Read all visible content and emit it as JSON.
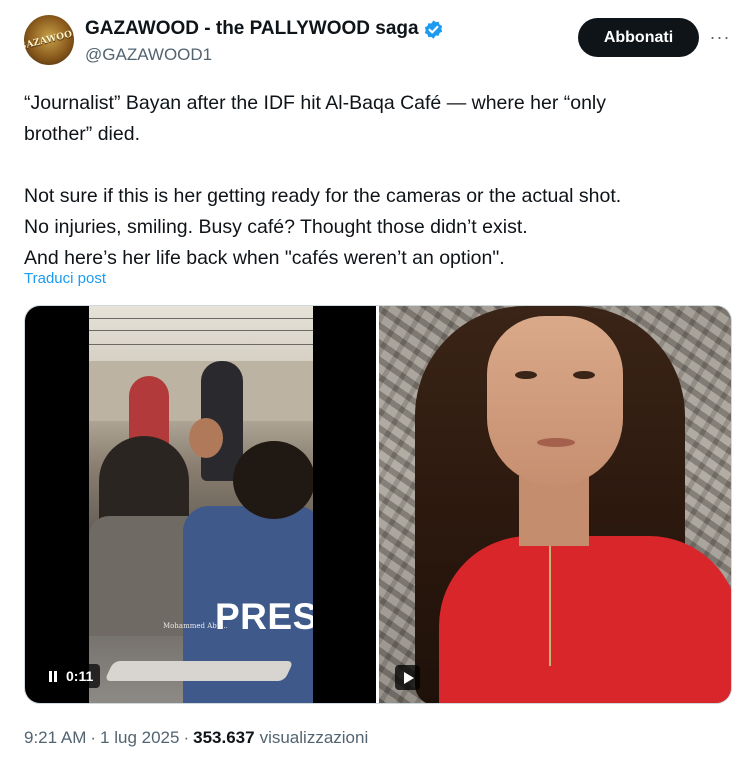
{
  "author": {
    "display_name": "GAZAWOOD - the PALLYWOOD saga",
    "handle": "@GAZAWOOD1",
    "avatar_text": "GAZAWOOD",
    "verified": true,
    "verified_color": "#1d9bf0"
  },
  "actions": {
    "follow_label": "Abbonati",
    "more_label": "···"
  },
  "tweet": {
    "lines": [
      "“Journalist” Bayan after the IDF hit Al-Baqa Café — where her “only",
      "brother” died.",
      "Not sure if this is her getting ready for the cameras or the actual shot.",
      "No injuries, smiling. Busy café? Thought those didn’t exist.",
      "And here’s her life back when \"cafés weren’t an option\"."
    ],
    "translate_label": "Traduci post"
  },
  "media": {
    "video_left": {
      "timestamp": "0:11",
      "state": "playing",
      "vest_text": "PRES",
      "watermark": "Mohammed Abu..."
    },
    "video_right": {
      "state": "paused"
    }
  },
  "meta": {
    "time": "9:21 AM",
    "date": "1 lug 2025",
    "separator": "·",
    "views_count": "353.637",
    "views_label": "visualizzazioni"
  },
  "colors": {
    "text_primary": "#0f1419",
    "text_secondary": "#536471",
    "link": "#1d9bf0",
    "button_bg": "#0f1419"
  }
}
